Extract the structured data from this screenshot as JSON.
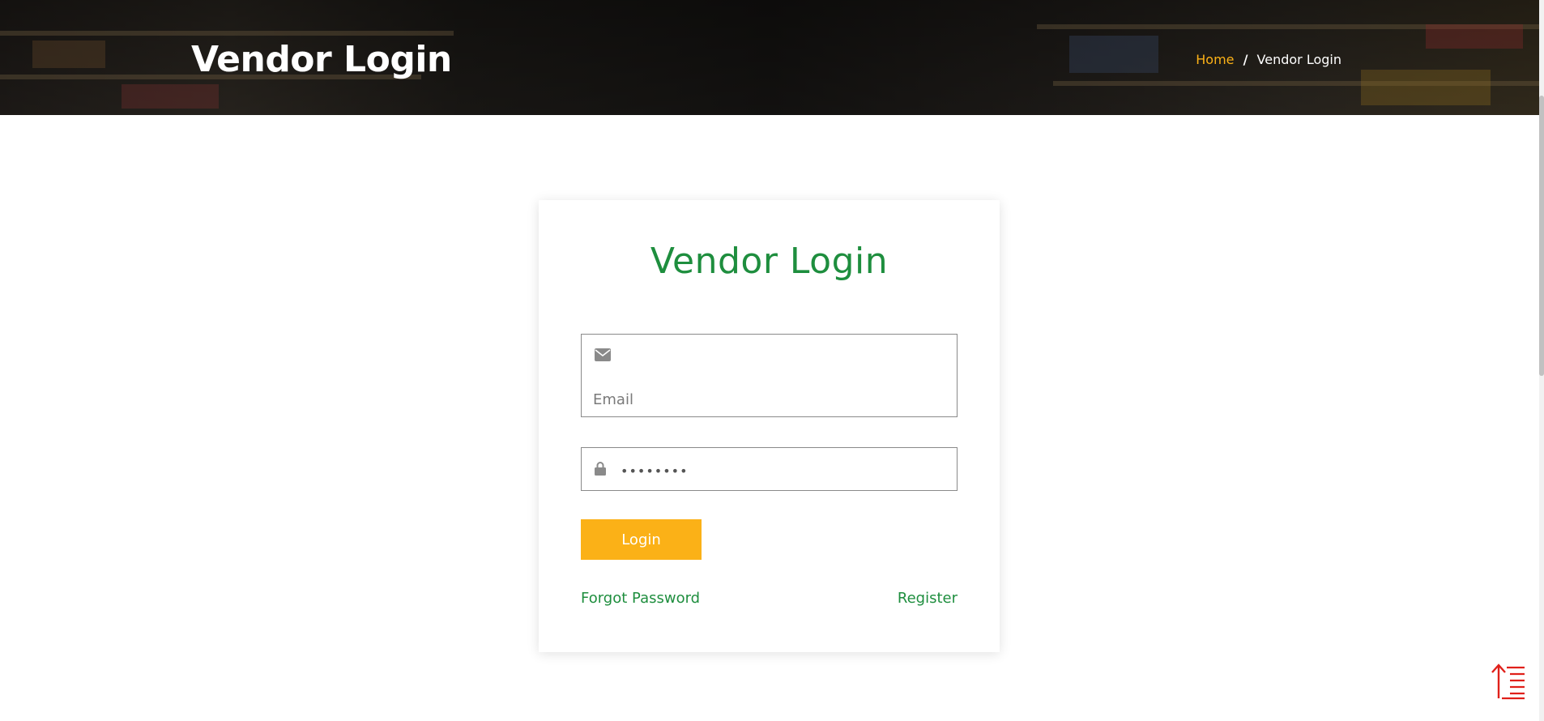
{
  "hero": {
    "title": "Vendor Login",
    "breadcrumb": {
      "home": "Home",
      "separator": "/",
      "current": "Vendor Login"
    }
  },
  "login_card": {
    "title": "Vendor Login",
    "email": {
      "placeholder": "Email",
      "value": "",
      "icon": "envelope-icon"
    },
    "password": {
      "value": "password",
      "icon": "lock-icon"
    },
    "login_button": "Login",
    "forgot_password": "Forgot Password",
    "register": "Register"
  },
  "back_to_top": {
    "icon": "back-to-top-icon"
  },
  "colors": {
    "accent_orange": "#fbb117",
    "brand_green": "#1e8e3e",
    "back_to_top_red": "#e0201a"
  }
}
